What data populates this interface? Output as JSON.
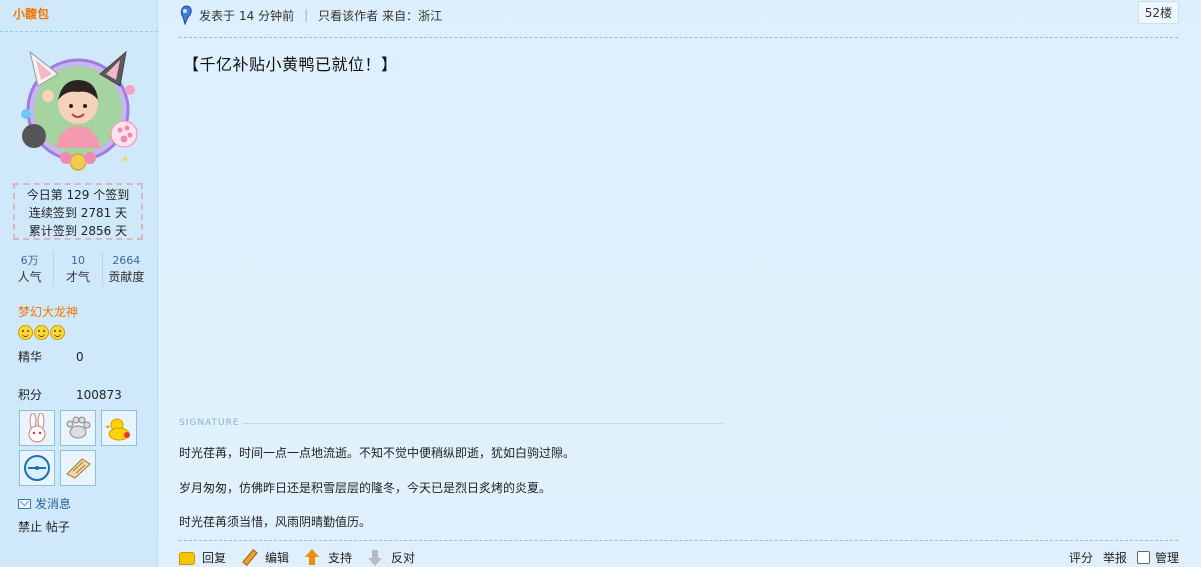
{
  "user": {
    "name": "小馥包",
    "checkin": {
      "line1": "今日第 129 个签到",
      "line2": "连续签到 2781 天",
      "line3": "累计签到 2856 天"
    },
    "stats": [
      {
        "value": "6万",
        "label": "人气"
      },
      {
        "value": "10",
        "label": "才气"
      },
      {
        "value": "2664",
        "label": "贡献度"
      }
    ],
    "rank": "梦幻大龙神",
    "essence_label": "精华",
    "essence_value": "0",
    "points_label": "积分",
    "points_value": "100873",
    "medals": [
      "rabbit-medal-icon",
      "paw-medal-icon",
      "duck-medal-icon",
      "clock-medal-icon",
      "scroll-medal-icon"
    ],
    "send_message": "发消息",
    "ban_label": "禁止",
    "posts_label": "帖子"
  },
  "post": {
    "posted_prefix": "发表于",
    "posted_time": "14 分钟前",
    "only_author": "只看该作者",
    "from_label": "来自：浙江",
    "floor": "52楼",
    "content": "【千亿补贴小黄鸭已就位！】"
  },
  "signature": {
    "label": "SIGNATURE",
    "lines": [
      "时光荏苒，时间一点一点地流逝。不知不觉中便稍纵即逝，犹如白驹过隙。",
      "岁月匆匆，仿佛昨日还是积雪层层的隆冬，今天已是烈日炙烤的炎夏。",
      "时光荏苒须当惜，风雨阴晴勤值历。"
    ]
  },
  "actions": {
    "reply": "回复",
    "edit": "编辑",
    "support": "支持",
    "oppose": "反对",
    "rate": "评分",
    "report": "举报",
    "manage": "管理"
  },
  "colors": {
    "accent_orange": "#f07800",
    "sidebar_bg": "#cfe9fb",
    "main_bg": "#ddeffd",
    "link_blue": "#2a5f98"
  }
}
